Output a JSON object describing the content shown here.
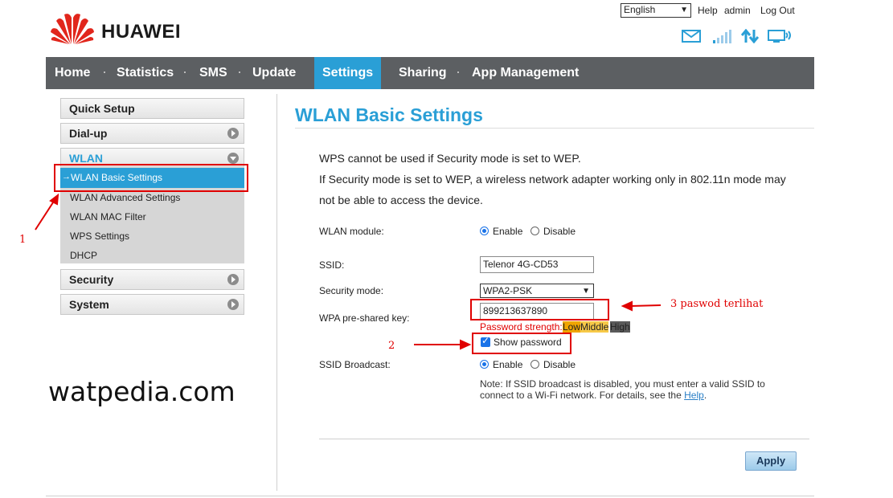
{
  "header": {
    "brand": "HUAWEI",
    "language": "English",
    "links": {
      "help": "Help",
      "user": "admin",
      "logout": "Log Out"
    }
  },
  "nav": {
    "items": [
      "Home",
      "Statistics",
      "SMS",
      "Update",
      "Settings",
      "Sharing",
      "App Management"
    ],
    "active": "Settings"
  },
  "sidebar": {
    "quick_setup": "Quick Setup",
    "dialup": "Dial-up",
    "wlan": "WLAN",
    "wlan_items": [
      "WLAN Basic Settings",
      "WLAN Advanced Settings",
      "WLAN MAC Filter",
      "WPS Settings",
      "DHCP"
    ],
    "security": "Security",
    "system": "System"
  },
  "main": {
    "title": "WLAN Basic Settings",
    "notice1": "WPS cannot be used if Security mode is set to WEP.",
    "notice2a": "If Security mode is set to WEP, a wireless network adapter working only in 802.11n mode may",
    "notice2b": "not be able to access the device.",
    "wlan_module_label": "WLAN module:",
    "enable": "Enable",
    "disable": "Disable",
    "ssid_label": "SSID:",
    "ssid_value": "Telenor 4G-CD53",
    "security_mode_label": "Security mode:",
    "security_mode_value": "WPA2-PSK",
    "wpa_key_label": "WPA pre-shared key:",
    "wpa_key_value": "899213637890",
    "strength_label": "Password strength:",
    "strength_low": "Low",
    "strength_middle": "Middle",
    "strength_high": "High",
    "show_password": "Show password",
    "ssid_broadcast_label": "SSID Broadcast:",
    "note_text": "Note: If SSID broadcast is disabled, you must enter a valid SSID to connect to a Wi-Fi network. For details, see the",
    "note_link": "Help",
    "note_end": ".",
    "apply": "Apply"
  },
  "annotations": {
    "n1": "1",
    "n2": "2",
    "n3": "3 paswod terlihat",
    "watermark": "watpedia.com"
  },
  "colors": {
    "accent": "#2a9fd6",
    "nav_bg": "#5c5f62",
    "annotation": "#e00000",
    "strength_low": "#f0a500",
    "strength_middle": "#f7c948",
    "strength_high": "#5a5a5a"
  }
}
